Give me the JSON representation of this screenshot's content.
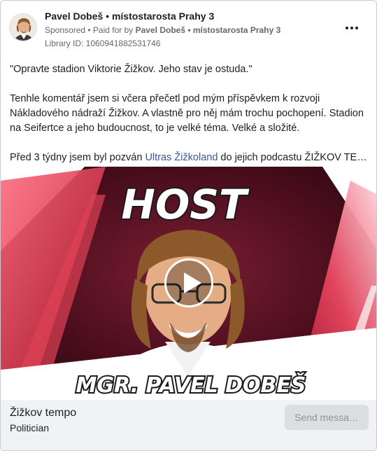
{
  "header": {
    "author": "Pavel Dobeš • místostarosta Prahy 3",
    "sponsored": "Sponsored",
    "paid_for_prefix": " • Paid for by ",
    "paid_for_by": "Pavel Dobeš • místostarosta Prahy 3",
    "library_id": "Library ID: 1060941882531746",
    "more_icon": "more-horizontal-icon"
  },
  "post": {
    "paragraph_1": "\"Opravte stadion Viktorie Žižkov. Jeho stav je ostuda.\"",
    "paragraph_2": "Tenhle komentář jsem si včera přečetl pod mým příspěvkem k rozvoji Nákladového nádraží Žižkov. A vlastně pro něj mám trochu pochopení. Stadion na Seifertce a jeho budoucnost, to je velké téma. Velké a složité.",
    "paragraph_3_start": "Před 3 týdny jsem byl pozván ",
    "paragraph_3_link": "Ultras Žižkoland",
    "paragraph_3_end": " do jejich podcastu ŽIŽKOV TEMPO…"
  },
  "media": {
    "host_label": "HOST",
    "name_label": "MGR. PAVEL DOBEŠ",
    "play_icon": "play-icon"
  },
  "footer": {
    "page_name": "Žižkov tempo",
    "page_category": "Politician",
    "send_button": "Send messa…"
  },
  "colors": {
    "link": "#385898",
    "background_dark": "#4a0d1c",
    "accent_red": "#d8304a",
    "footer_bg": "#f0f2f5"
  }
}
